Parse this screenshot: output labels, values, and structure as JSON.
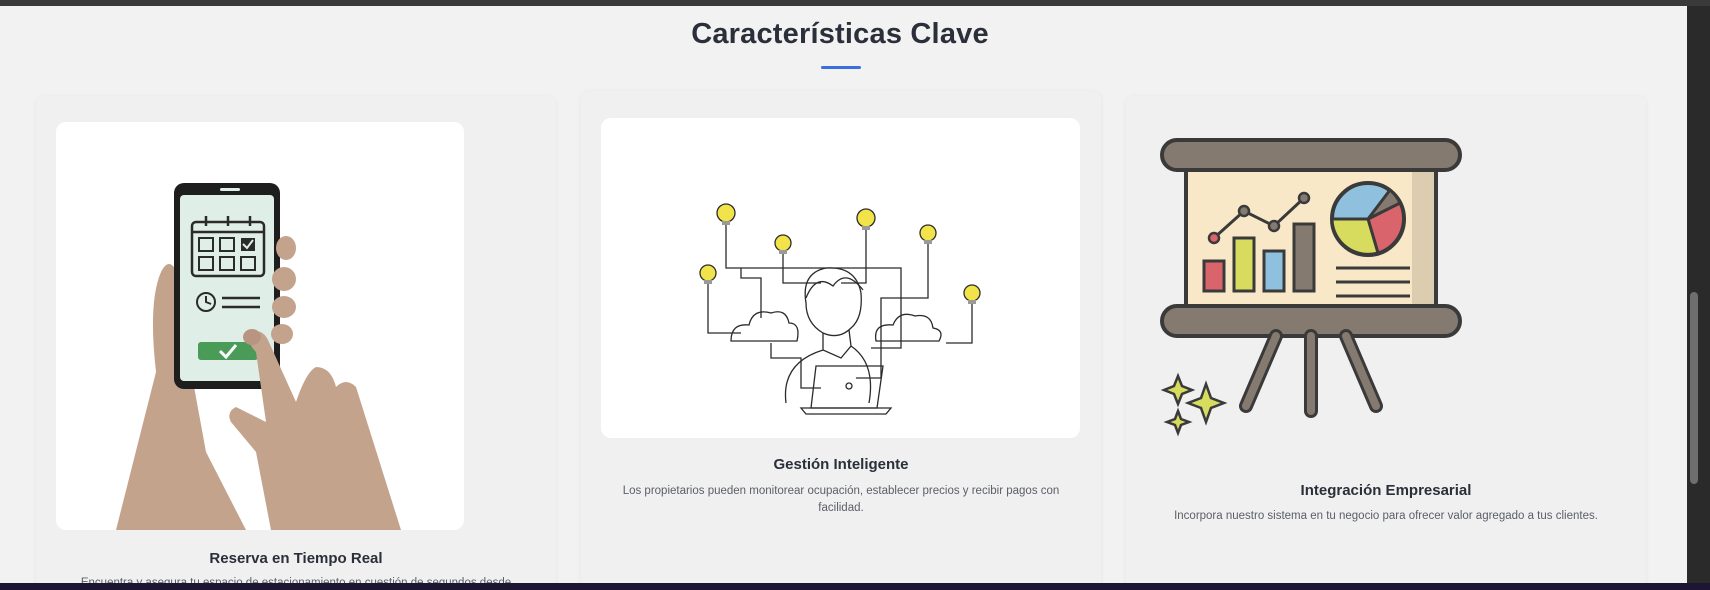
{
  "section": {
    "title": "Características Clave",
    "accent_color": "#3b6fe0"
  },
  "features": [
    {
      "title": "Reserva en Tiempo Real",
      "description": "Encuentra y asegura tu espacio de estacionamiento en cuestión de segundos desde cualquier",
      "illustration": "phone-booking-icon"
    },
    {
      "title": "Gestión Inteligente",
      "description": "Los propietarios pueden monitorear ocupación, establecer precios y recibir pagos con facilidad.",
      "illustration": "person-lightbulbs-icon"
    },
    {
      "title": "Integración Empresarial",
      "description": "Incorpora nuestro sistema en tu negocio para ofrecer valor agregado a tus clientes.",
      "illustration": "presentation-board-icon"
    }
  ]
}
